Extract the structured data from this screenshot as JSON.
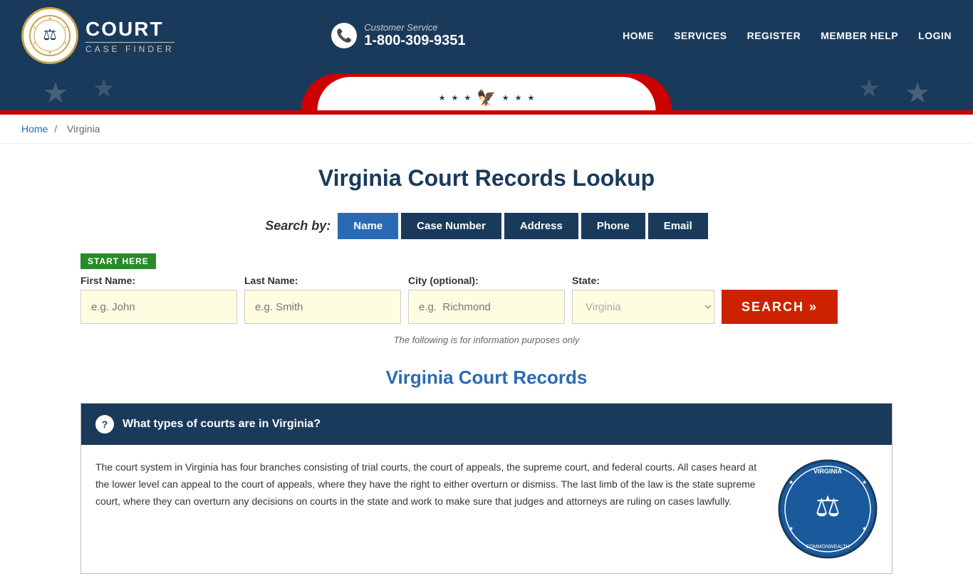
{
  "header": {
    "logo_court": "COURT",
    "logo_case_finder": "CASE FINDER",
    "customer_service_label": "Customer Service",
    "phone_number": "1-800-309-9351",
    "nav": {
      "home": "HOME",
      "services": "SERVICES",
      "register": "REGISTER",
      "member_help": "MEMBER HELP",
      "login": "LOGIN"
    }
  },
  "breadcrumb": {
    "home": "Home",
    "separator": "/",
    "current": "Virginia"
  },
  "main": {
    "page_title": "Virginia Court Records Lookup",
    "search_by_label": "Search by:",
    "search_tabs": [
      {
        "id": "name",
        "label": "Name",
        "active": true
      },
      {
        "id": "case_number",
        "label": "Case Number",
        "active": false
      },
      {
        "id": "address",
        "label": "Address",
        "active": false
      },
      {
        "id": "phone",
        "label": "Phone",
        "active": false
      },
      {
        "id": "email",
        "label": "Email",
        "active": false
      }
    ],
    "start_here_badge": "START HERE",
    "fields": {
      "first_name_label": "First Name:",
      "first_name_placeholder": "e.g. John",
      "last_name_label": "Last Name:",
      "last_name_placeholder": "e.g. Smith",
      "city_label": "City (optional):",
      "city_placeholder": "e.g.  Richmond",
      "state_label": "State:",
      "state_default": "Virginia"
    },
    "search_button": "SEARCH »",
    "disclaimer": "The following is for information purposes only",
    "section_title": "Virginia Court Records",
    "faq": {
      "question": "What types of courts are in Virginia?",
      "icon": "?",
      "body": "The court system in Virginia has four branches consisting of trial courts, the court of appeals, the supreme court, and federal courts. All cases heard at the lower level can appeal to the court of appeals, where they have the right to either overturn or dismiss. The last limb of the law is the state supreme court, where they can overturn any decisions on courts in the state and work to make sure that judges and attorneys are ruling on cases lawfully."
    }
  }
}
